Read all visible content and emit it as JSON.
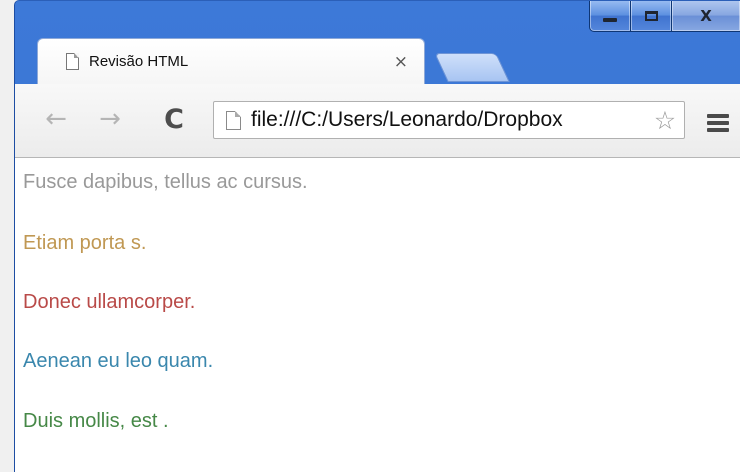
{
  "browser": {
    "tab": {
      "title": "Revisão HTML",
      "close_glyph": "×"
    },
    "window_controls": {
      "minimize": "minimize-icon",
      "maximize": "maximize-icon",
      "close_glyph": "X"
    },
    "toolbar": {
      "back_glyph": "←",
      "forward_glyph": "→",
      "reload_glyph": "C",
      "url": "file:///C:/Users/Leonardo/Dropbox",
      "bookmark_glyph": "☆"
    },
    "colors": {
      "frame": "#3a74d2"
    }
  },
  "page": {
    "lines": [
      {
        "text": "Fusce dapibus, tellus ac cursus.",
        "color": "#999999"
      },
      {
        "text": "Etiam porta s.",
        "color": "#c09853"
      },
      {
        "text": "Donec ullamcorper.",
        "color": "#b94a48"
      },
      {
        "text": "Aenean eu leo quam.",
        "color": "#3a87ad"
      },
      {
        "text": "Duis mollis, est .",
        "color": "#468847"
      }
    ]
  }
}
